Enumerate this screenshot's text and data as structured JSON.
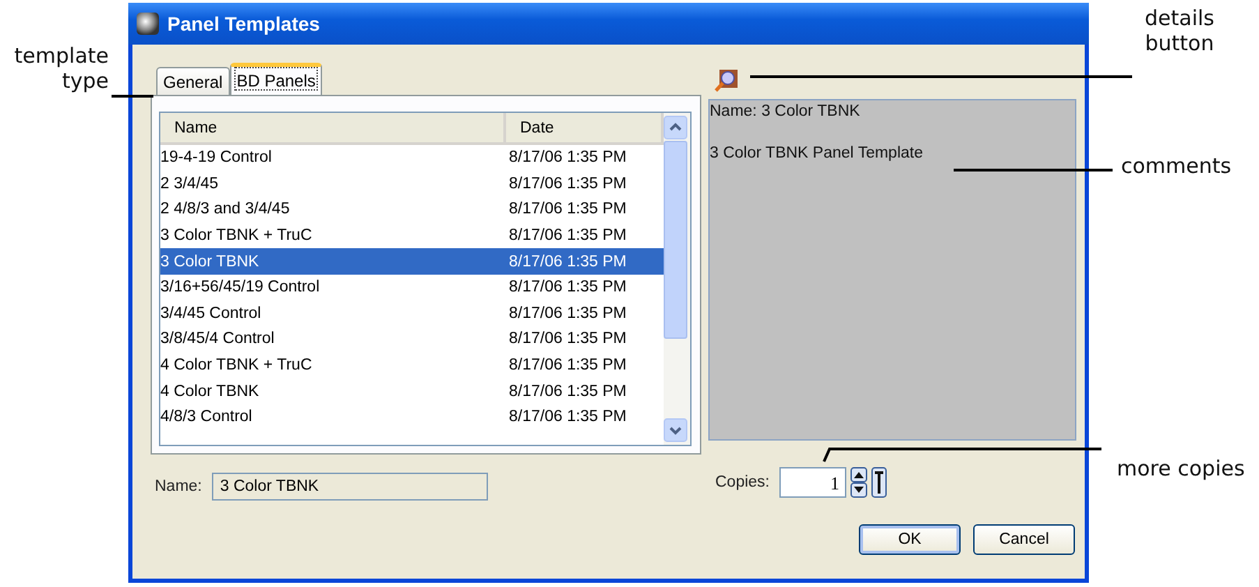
{
  "window": {
    "title": "Panel Templates"
  },
  "tabs": [
    {
      "label": "General",
      "selected": false
    },
    {
      "label": "BD Panels",
      "selected": true
    }
  ],
  "table": {
    "columns": [
      "Name",
      "Date"
    ],
    "rows": [
      {
        "name": "19-4-19 Control",
        "date": "8/17/06 1:35 PM",
        "selected": false
      },
      {
        "name": "2 3/4/45",
        "date": "8/17/06 1:35 PM",
        "selected": false
      },
      {
        "name": "2 4/8/3 and 3/4/45",
        "date": "8/17/06 1:35 PM",
        "selected": false
      },
      {
        "name": "3 Color TBNK + TruC",
        "date": "8/17/06 1:35 PM",
        "selected": false
      },
      {
        "name": "3 Color TBNK",
        "date": "8/17/06 1:35 PM",
        "selected": true
      },
      {
        "name": "3/16+56/45/19 Control",
        "date": "8/17/06 1:35 PM",
        "selected": false
      },
      {
        "name": "3/4/45 Control",
        "date": "8/17/06 1:35 PM",
        "selected": false
      },
      {
        "name": "3/8/45/4 Control",
        "date": "8/17/06 1:35 PM",
        "selected": false
      },
      {
        "name": "4 Color TBNK + TruC",
        "date": "8/17/06 1:35 PM",
        "selected": false
      },
      {
        "name": "4 Color TBNK",
        "date": "8/17/06 1:35 PM",
        "selected": false
      },
      {
        "name": "4/8/3 Control",
        "date": "8/17/06 1:35 PM",
        "selected": false
      }
    ]
  },
  "name_field": {
    "label": "Name:",
    "value": "3 Color TBNK"
  },
  "details": {
    "lines": [
      "Name: 3 Color TBNK",
      "3 Color TBNK Panel Template"
    ]
  },
  "copies": {
    "label": "Copies:",
    "value": "1"
  },
  "buttons": [
    "OK",
    "Cancel"
  ],
  "callouts": [
    "template type",
    "details button",
    "comments",
    "more copies"
  ]
}
